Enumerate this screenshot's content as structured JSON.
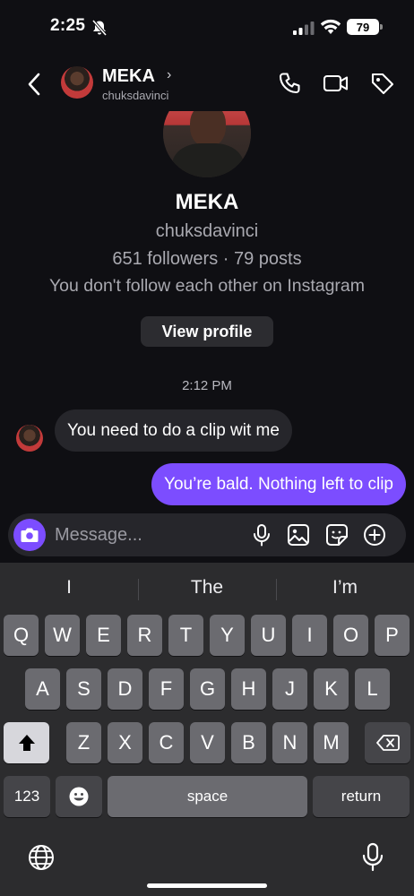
{
  "status_bar": {
    "time": "2:25",
    "battery": "79"
  },
  "header": {
    "name": "MEKA",
    "username": "chuksdavinci",
    "chevron": "›"
  },
  "profile": {
    "name": "MEKA",
    "username": "chuksdavinci",
    "stats": "651 followers · 79 posts",
    "note": "You don't follow each other on Instagram",
    "view_profile_label": "View profile"
  },
  "conversation": {
    "timestamp": "2:12 PM",
    "messages": [
      {
        "direction": "incoming",
        "text": "You need to do a clip wit me"
      },
      {
        "direction": "outgoing",
        "text": "You’re bald. Nothing left to clip"
      }
    ]
  },
  "composer": {
    "placeholder": "Message..."
  },
  "keyboard": {
    "predictions": [
      "I",
      "The",
      "I’m"
    ],
    "row1": [
      "Q",
      "W",
      "E",
      "R",
      "T",
      "Y",
      "U",
      "I",
      "O",
      "P"
    ],
    "row2": [
      "A",
      "S",
      "D",
      "F",
      "G",
      "H",
      "J",
      "K",
      "L"
    ],
    "row3": [
      "Z",
      "X",
      "C",
      "V",
      "B",
      "N",
      "M"
    ],
    "numbers_label": "123",
    "space_label": "space",
    "return_label": "return"
  },
  "colors": {
    "accent": "#7c4dff",
    "background": "#0f0f13",
    "bubble_incoming": "#26262b",
    "keyboard": "#2c2c2e"
  },
  "icons": [
    "bell-slash-icon",
    "signal-icon",
    "wifi-icon",
    "back-chevron-icon",
    "phone-icon",
    "video-icon",
    "tag-icon",
    "camera-icon",
    "microphone-icon",
    "image-icon",
    "sticker-icon",
    "plus-circle-icon",
    "shift-icon",
    "backspace-icon",
    "emoji-icon",
    "globe-icon",
    "dictation-mic-icon"
  ]
}
